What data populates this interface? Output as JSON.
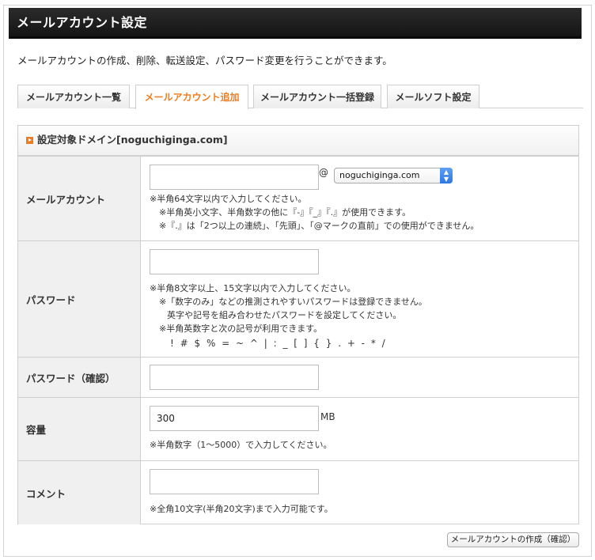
{
  "header": {
    "title": "メールアカウント設定"
  },
  "intro": "メールアカウントの作成、削除、転送設定、パスワード変更を行うことができます。",
  "tabs": [
    {
      "label": "メールアカウント一覧",
      "active": false
    },
    {
      "label": "メールアカウント追加",
      "active": true
    },
    {
      "label": "メールアカウント一括登録",
      "active": false
    },
    {
      "label": "メールソフト設定",
      "active": false
    }
  ],
  "domain_bar": "設定対象ドメイン[noguchiginga.com]",
  "account": {
    "label": "メールアカウント",
    "value": "",
    "at": "@",
    "domain_selected": "noguchiginga.com",
    "notes": [
      "※半角64文字以内で入力してください。",
      "※半角英小文字、半角数字の他に『-』『_』『.』が使用できます。",
      "※『.』は「2つ以上の連続」、「先頭」、「@マークの直前」での使用ができません。"
    ]
  },
  "password": {
    "label": "パスワード",
    "value": "",
    "notes": [
      "※半角8文字以上、15文字以内で入力してください。",
      "※「数字のみ」などの推測されやすいパスワードは登録できません。",
      "英字や記号を組み合わせたパスワードを設定してください。",
      "※半角英数字と次の記号が利用できます。",
      "! # $ % = ~ ^ | : _ [ ] { } . + - * /"
    ]
  },
  "password_confirm": {
    "label": "パスワード（確認）",
    "value": ""
  },
  "capacity": {
    "label": "容量",
    "value": "300",
    "unit": "MB",
    "note": "※半角数字（1〜5000）で入力してください。"
  },
  "comment": {
    "label": "コメント",
    "value": "",
    "note": "※全角10文字(半角20文字)まで入力可能です。"
  },
  "submit_label": "メールアカウントの作成（確認）",
  "colors": {
    "accent": "#f07c1e",
    "header_bg": "#1c1c1c",
    "label_bg": "#f0f0f0",
    "select_arrow": "#3b82e8"
  }
}
